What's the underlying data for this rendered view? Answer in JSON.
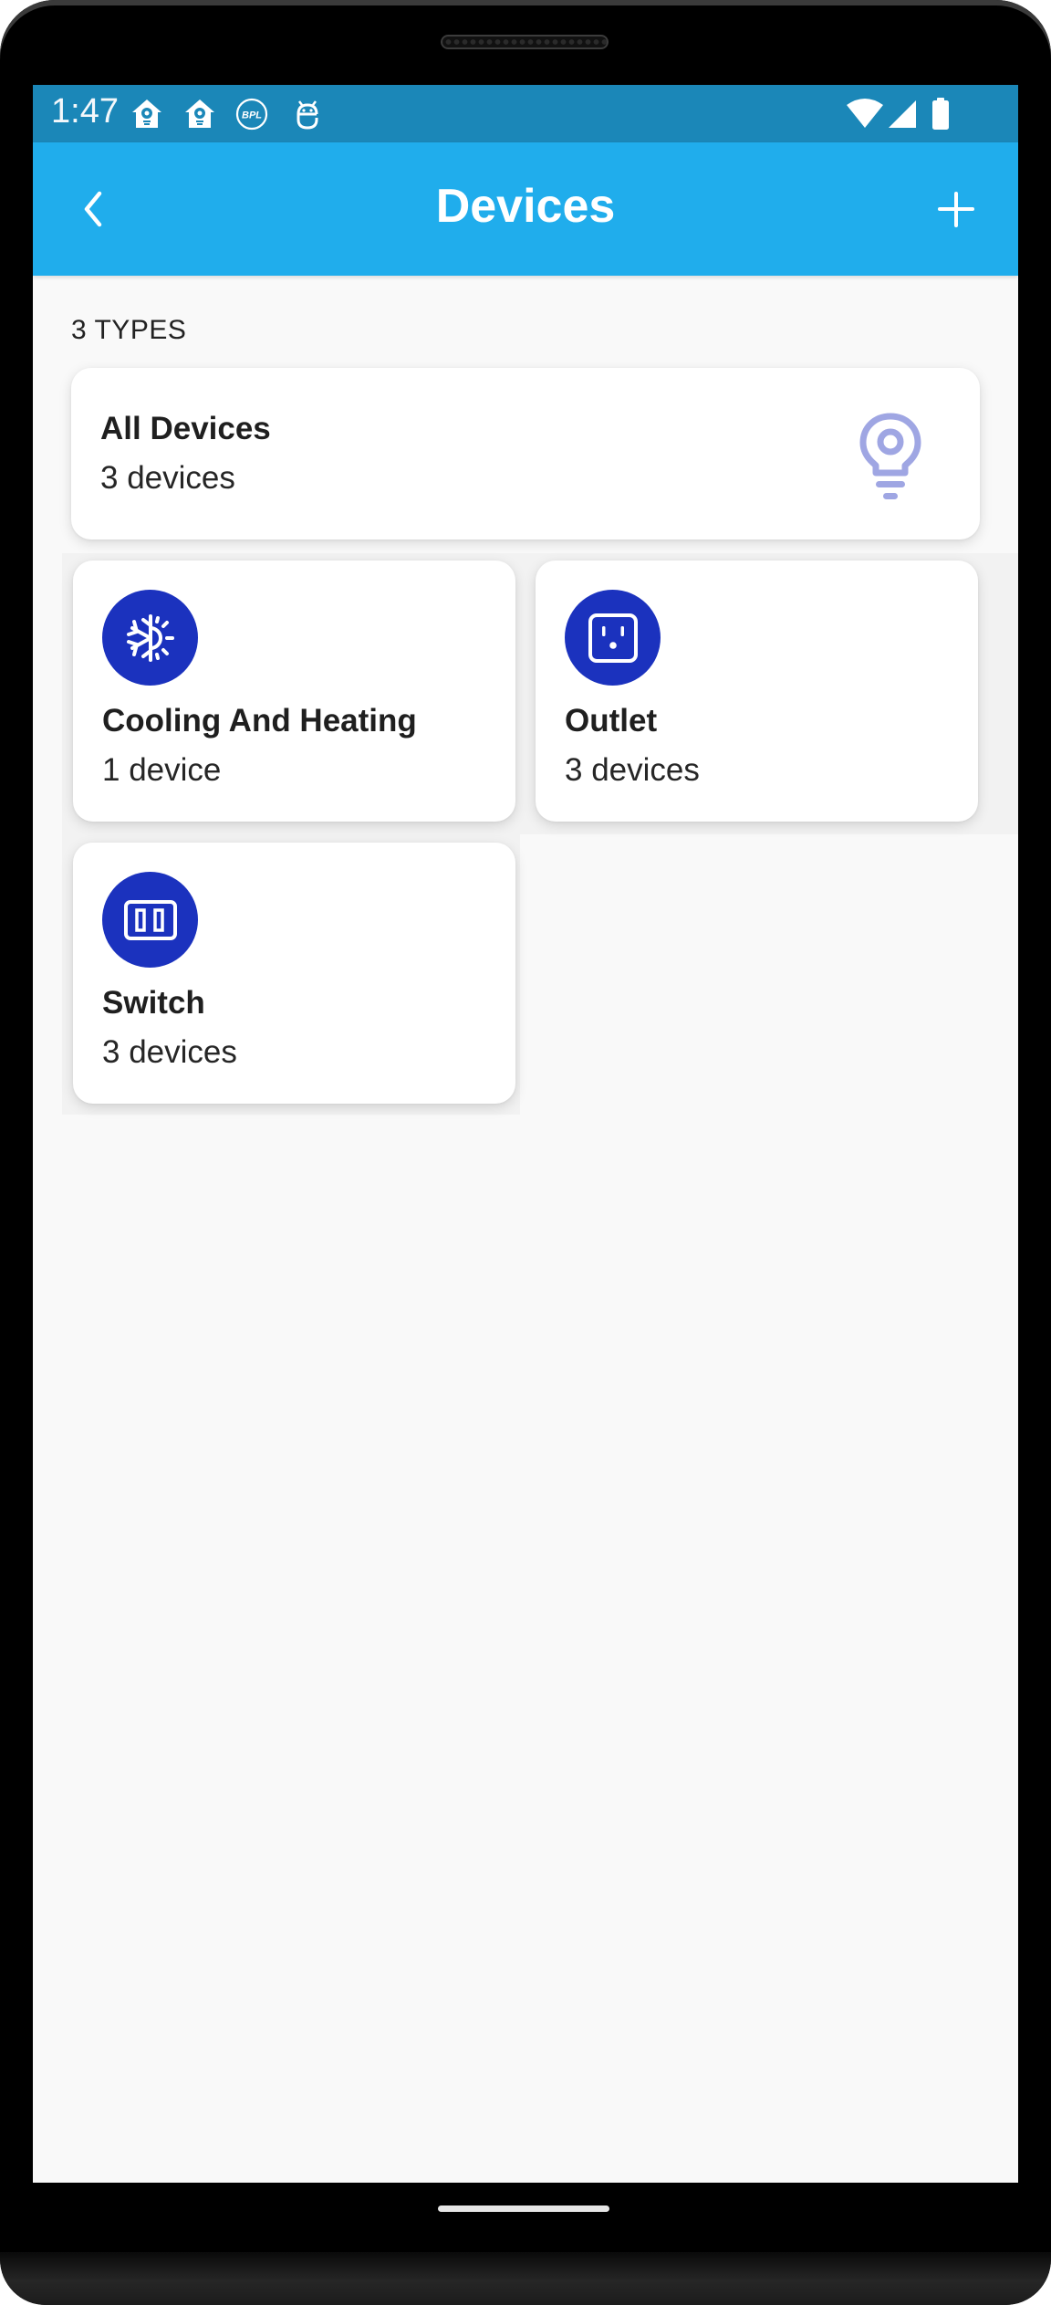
{
  "status_bar": {
    "time": "1:47",
    "notification_icons": [
      "home-bulb-icon",
      "home-bulb-icon",
      "bpl-logo-icon",
      "robot-app-icon"
    ],
    "system_icons": [
      "wifi-icon",
      "cellular-signal-icon",
      "battery-icon"
    ]
  },
  "header": {
    "title": "Devices",
    "back_icon": "chevron-left-icon",
    "add_icon": "plus-icon"
  },
  "section": {
    "label": "3 TYPES"
  },
  "all_devices": {
    "title": "All Devices",
    "subtitle": "3 devices",
    "icon": "lightbulb-icon",
    "icon_color": "#9fa6e3"
  },
  "device_types": [
    {
      "title": "Cooling And Heating",
      "subtitle": "1 device",
      "icon": "snowflake-sun-icon"
    },
    {
      "title": "Outlet",
      "subtitle": "3 devices",
      "icon": "outlet-icon"
    },
    {
      "title": "Switch",
      "subtitle": "3 devices",
      "icon": "switch-icon"
    }
  ],
  "colors": {
    "status_bar": "#1b87b8",
    "header": "#20adec",
    "icon_circle": "#1b32be",
    "background": "#f9f9f9"
  }
}
